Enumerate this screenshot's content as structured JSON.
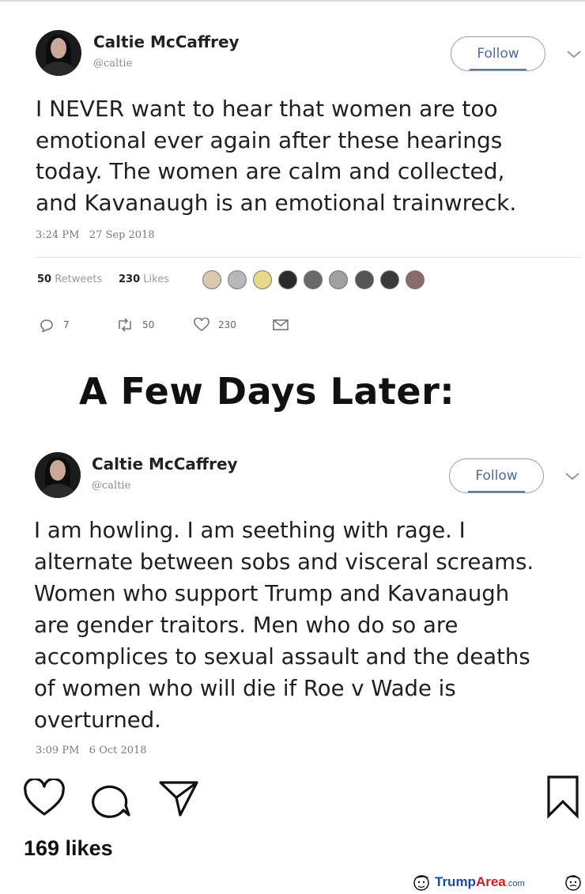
{
  "tweet1": {
    "author_name": "Caltie McCaffrey",
    "author_handle": "@caltie",
    "follow_label": "Follow",
    "text_lines": [
      "I NEVER want to hear that women are too",
      "emotional ever again after these hearings",
      "today.  The women are calm and collected,",
      "and Kavanaugh is an emotional trainwreck."
    ],
    "time": "3:24 PM",
    "date": "27 Sep 2018",
    "retweets_count": "50",
    "retweets_label": "Retweets",
    "likes_count": "230",
    "likes_label": "Likes",
    "reply_count": "7",
    "retweet_action_count": "50",
    "like_action_count": "230"
  },
  "headline": "A Few Days Later:",
  "tweet2": {
    "author_name": "Caltie McCaffrey",
    "author_handle": "@caltie",
    "follow_label": "Follow",
    "text_lines": [
      "I am howling.  I am seething with rage.  I",
      "alternate between sobs and visceral screams.",
      "Women who support Trump and Kavanaugh",
      "are gender traitors.  Men who do so are",
      "accomplices to sexual assault and the deaths",
      "of women who will die if Roe v Wade is",
      "overturned."
    ],
    "time": "3:09 PM",
    "date": "6 Oct 2018"
  },
  "post": {
    "likes_text": "169 likes"
  },
  "watermark": {
    "trump": "Trump",
    "area": "Area",
    "dotcom": ".com"
  },
  "icons": {
    "heart": "heart-icon",
    "comment": "comment-icon",
    "share": "paper-plane-icon",
    "bookmark": "bookmark-icon"
  },
  "colors": {
    "follow_text": "#4a6d99",
    "watermark_blue": "#1b4b9a",
    "watermark_red": "#d11b1b"
  }
}
